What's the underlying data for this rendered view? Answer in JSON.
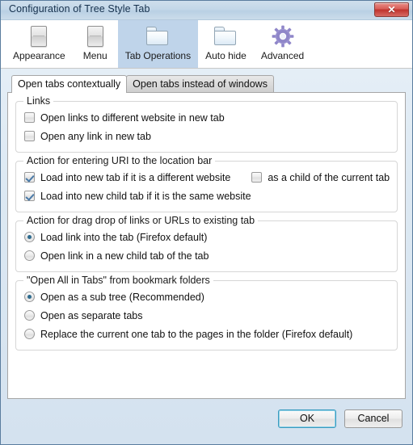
{
  "window": {
    "title": "Configuration of Tree Style Tab",
    "close_label": "✕"
  },
  "toolbar": {
    "items": [
      {
        "label": "Appearance",
        "icon": "window-icon",
        "selected": false
      },
      {
        "label": "Menu",
        "icon": "window-icon",
        "selected": false
      },
      {
        "label": "Tab Operations",
        "icon": "folder-icon",
        "selected": true
      },
      {
        "label": "Auto hide",
        "icon": "folder-icon",
        "selected": false
      },
      {
        "label": "Advanced",
        "icon": "gear-icon",
        "selected": false
      }
    ]
  },
  "tabs": [
    {
      "label": "Open tabs contextually",
      "active": true
    },
    {
      "label": "Open tabs instead of windows",
      "active": false
    }
  ],
  "groups": [
    {
      "title": "Links",
      "rows": [
        {
          "type": "checkbox",
          "checked": false,
          "label": "Open links to different website in new tab"
        },
        {
          "type": "checkbox",
          "checked": false,
          "label": "Open any link in new tab"
        }
      ]
    },
    {
      "title": "Action for entering URI to the location bar",
      "rows": [
        {
          "type": "checkbox",
          "checked": true,
          "label": "Load into new tab if it is a different website",
          "extra": {
            "type": "checkbox",
            "checked": false,
            "label": "as a child of the current tab"
          }
        },
        {
          "type": "checkbox",
          "checked": true,
          "label": "Load into new child tab if it is the same website"
        }
      ]
    },
    {
      "title": "Action for drag drop of links or URLs to existing tab",
      "rows": [
        {
          "type": "radio",
          "checked": true,
          "label": "Load link into the tab (Firefox default)"
        },
        {
          "type": "radio",
          "checked": false,
          "label": "Open link in a new child tab of the tab"
        }
      ]
    },
    {
      "title": "\"Open All in Tabs\" from bookmark folders",
      "rows": [
        {
          "type": "radio",
          "checked": true,
          "label": "Open as a sub tree (Recommended)"
        },
        {
          "type": "radio",
          "checked": false,
          "label": "Open as separate tabs"
        },
        {
          "type": "radio",
          "checked": false,
          "label": "Replace the current one tab to the pages in the folder (Firefox default)"
        }
      ]
    }
  ],
  "buttons": {
    "ok": "OK",
    "cancel": "Cancel"
  },
  "colors": {
    "accent": "#3a9bbf",
    "selected_tool_bg": "#bfd4ea",
    "close_red": "#c0342e",
    "gear_purple": "#8f86c9",
    "check_blue": "#4a7aa8",
    "radio_dot": "#2e6b8e"
  }
}
